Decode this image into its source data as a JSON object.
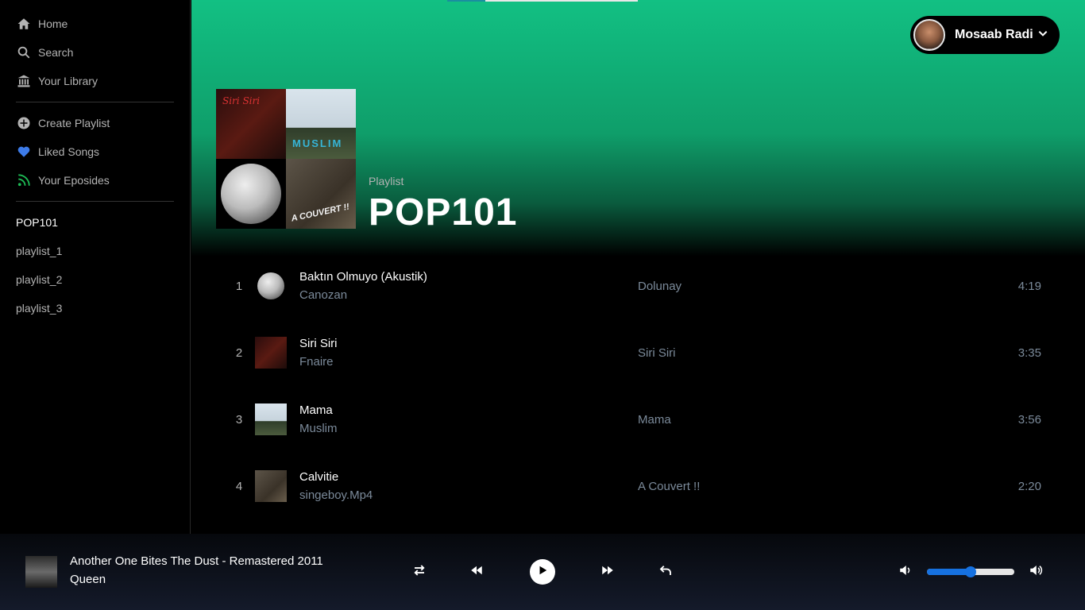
{
  "sidebar": {
    "nav": [
      {
        "label": "Home",
        "icon": "home-icon"
      },
      {
        "label": "Search",
        "icon": "search-icon"
      },
      {
        "label": "Your Library",
        "icon": "library-icon"
      }
    ],
    "actions": [
      {
        "label": "Create Playlist",
        "icon": "plus-circle-icon"
      },
      {
        "label": "Liked Songs",
        "icon": "heart-icon"
      },
      {
        "label": "Your Eposides",
        "icon": "rss-icon"
      }
    ],
    "playlists": [
      {
        "label": "POP101",
        "active": true
      },
      {
        "label": "playlist_1"
      },
      {
        "label": "playlist_2"
      },
      {
        "label": "playlist_3"
      }
    ]
  },
  "header": {
    "user_name": "Mosaab Radi"
  },
  "playlist": {
    "type_label": "Playlist",
    "title": "POP101"
  },
  "tracks": [
    {
      "num": "1",
      "title": "Baktın Olmuyo (Akustik)",
      "artist": "Canozan",
      "album": "Dolunay",
      "duration": "4:19"
    },
    {
      "num": "2",
      "title": "Siri Siri",
      "artist": "Fnaire",
      "album": "Siri Siri",
      "duration": "3:35"
    },
    {
      "num": "3",
      "title": "Mama",
      "artist": "Muslim",
      "album": "Mama",
      "duration": "3:56"
    },
    {
      "num": "4",
      "title": "Calvitie",
      "artist": "singeboy.Mp4",
      "album": "A Couvert !!",
      "duration": "2:20"
    }
  ],
  "player": {
    "now_title": "Another One Bites The Dust - Remastered 2011",
    "now_artist": "Queen",
    "volume": 0.5
  },
  "colors": {
    "accent": "#12c083",
    "volume": "#1671e0",
    "liked": "#3d7be8",
    "episodes": "#1db954"
  }
}
